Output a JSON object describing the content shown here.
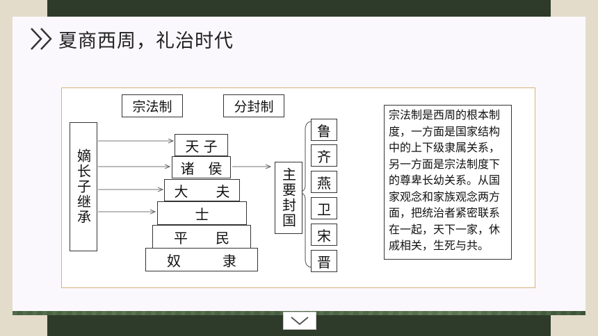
{
  "slide": {
    "title": "夏商西周，礼治时代"
  },
  "diagram": {
    "top_labels": [
      "宗法制",
      "分封制"
    ],
    "left_vertical": "嫡长子继承",
    "pyramid": [
      "天 子",
      "诸　侯",
      "大　　夫",
      "士",
      "平　　民",
      "奴　　　隶"
    ],
    "center_vertical": "主要封国",
    "states": [
      "鲁",
      "齐",
      "燕",
      "卫",
      "宋",
      "晋"
    ],
    "note": "宗法制是西周的根本制度，一方面是国家结构中的上下级隶属关系，另一方面是宗法制度下的尊卑长幼关系。从国家观念和家族观念两方面，把统治者紧密联系在一起，天下一家，休戚相关，生死与共。"
  },
  "colors": {
    "panel_border": "#d8b07c",
    "dark_band": "#2e3a2a",
    "side": "#e3dccb"
  },
  "icons": {
    "title_marker": "double-chevron-right-icon",
    "next": "chevron-down-icon"
  }
}
